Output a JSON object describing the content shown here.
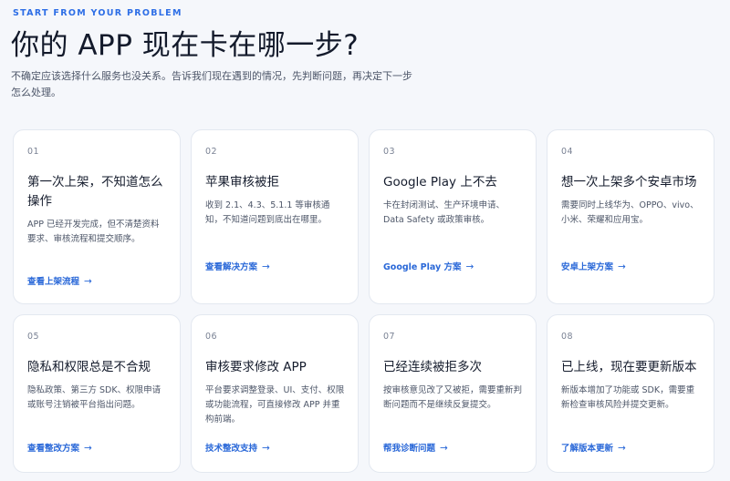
{
  "header": {
    "eyebrow": "START FROM YOUR PROBLEM",
    "title": "你的 APP 现在卡在哪一步?",
    "intro": "不确定应该选择什么服务也没关系。告诉我们现在遇到的情况，先判断问题，再决定下一步怎么处理。"
  },
  "cards": [
    {
      "num": "01",
      "title": "第一次上架，不知道怎么操作",
      "desc": "APP 已经开发完成，但不清楚资料要求、审核流程和提交顺序。",
      "link": "查看上架流程",
      "arrow": "→"
    },
    {
      "num": "02",
      "title": "苹果审核被拒",
      "desc": "收到 2.1、4.3、5.1.1 等审核通知，不知道问题到底出在哪里。",
      "link": "查看解决方案",
      "arrow": "→"
    },
    {
      "num": "03",
      "title": "Google Play 上不去",
      "desc": "卡在封闭测试、生产环境申请、Data Safety 或政策审核。",
      "link": "Google Play 方案",
      "arrow": "→"
    },
    {
      "num": "04",
      "title": "想一次上架多个安卓市场",
      "desc": "需要同时上线华为、OPPO、vivo、小米、荣耀和应用宝。",
      "link": "安卓上架方案",
      "arrow": "→"
    },
    {
      "num": "05",
      "title": "隐私和权限总是不合规",
      "desc": "隐私政策、第三方 SDK、权限申请或账号注销被平台指出问题。",
      "link": "查看整改方案",
      "arrow": "→"
    },
    {
      "num": "06",
      "title": "审核要求修改 APP",
      "desc": "平台要求调整登录、UI、支付、权限或功能流程，可直接修改 APP 并重构前端。",
      "link": "技术整改支持",
      "arrow": "→"
    },
    {
      "num": "07",
      "title": "已经连续被拒多次",
      "desc": "按审核意见改了又被拒，需要重新判断问题而不是继续反复提交。",
      "link": "帮我诊断问题",
      "arrow": "→"
    },
    {
      "num": "08",
      "title": "已上线，现在要更新版本",
      "desc": "新版本增加了功能或 SDK，需要重新检查审核风险并提交更新。",
      "link": "了解版本更新",
      "arrow": "→"
    }
  ]
}
